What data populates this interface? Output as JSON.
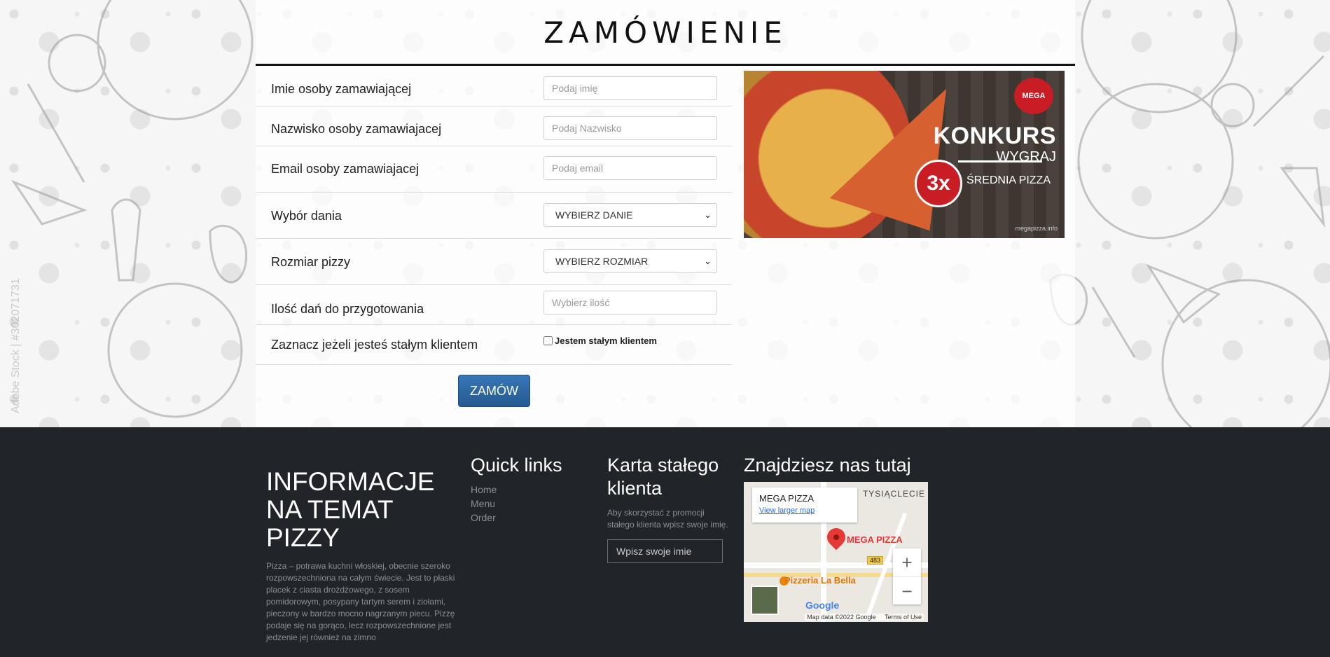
{
  "page": {
    "title": "ZAMÓWIENIE",
    "watermark": "Adobe Stock | #302071731"
  },
  "form": {
    "fields": [
      {
        "label": "Imie osoby zamawiającej",
        "placeholder": "Podaj imię"
      },
      {
        "label": "Nazwisko osoby zamawiajacej",
        "placeholder": "Podaj Nazwisko"
      },
      {
        "label": "Email osoby zamawiajacej",
        "placeholder": "Podaj email"
      },
      {
        "label": "Wybór dania",
        "value": "WYBIERZ DANIE"
      },
      {
        "label": "Rozmiar pizzy",
        "value": "WYBIERZ ROZMIAR"
      },
      {
        "label": "Ilość dań do przygotowania",
        "placeholder": "Wybierz ilość"
      },
      {
        "label": "Zaznacz jeżeli jesteś stałym klientem",
        "checkbox_label": "Jestem stałym klientem",
        "checked": false
      }
    ],
    "submit_label": "ZAMÓW"
  },
  "promo": {
    "logo": "MEGA",
    "headline": "KONKURS",
    "subheadline": "WYGRAJ",
    "badge": "3x",
    "prize": "ŚREDNIA PIZZA",
    "site": "megapizza.info"
  },
  "footer": {
    "info": {
      "heading": "INFORMACJE NA TEMAT PIZZY",
      "text": "Pizza – potrawa kuchni włoskiej, obecnie szeroko rozpowszechniona na całym świecie. Jest to płaski placek z ciasta drożdżowego, z sosem pomidorowym, posypany tartym serem i ziołami, pieczony w bardzo mocno nagrzanym piecu. Pizzę podaje się na gorąco, lecz rozpowszechnione jest jedzenie jej również na zimno"
    },
    "quick_links": {
      "heading": "Quick links",
      "links": [
        "Home",
        "Menu",
        "Order"
      ]
    },
    "loyalty": {
      "heading": "Karta stałego klienta",
      "text": "Aby skorzystać z promocji stałego klienta wpisz swoje imię.",
      "placeholder": "Wpisz swoje imie"
    },
    "location": {
      "heading": "Znajdziesz nas tutaj",
      "map": {
        "place_name": "MEGA PIZZA",
        "larger_map": "View larger map",
        "pin_label": "MEGA PIZZA",
        "poi": "Pizzeria La Bella",
        "district": "TYSIĄCLECIE",
        "road_number": "483",
        "logo": "Google",
        "attribution": "Map data ©2022 Google",
        "terms": "Terms of Use",
        "zoom_in": "+",
        "zoom_out": "−"
      }
    }
  },
  "colors": {
    "footer_bg": "#212529",
    "button": "#2c6aa8",
    "pin": "#e53935"
  }
}
